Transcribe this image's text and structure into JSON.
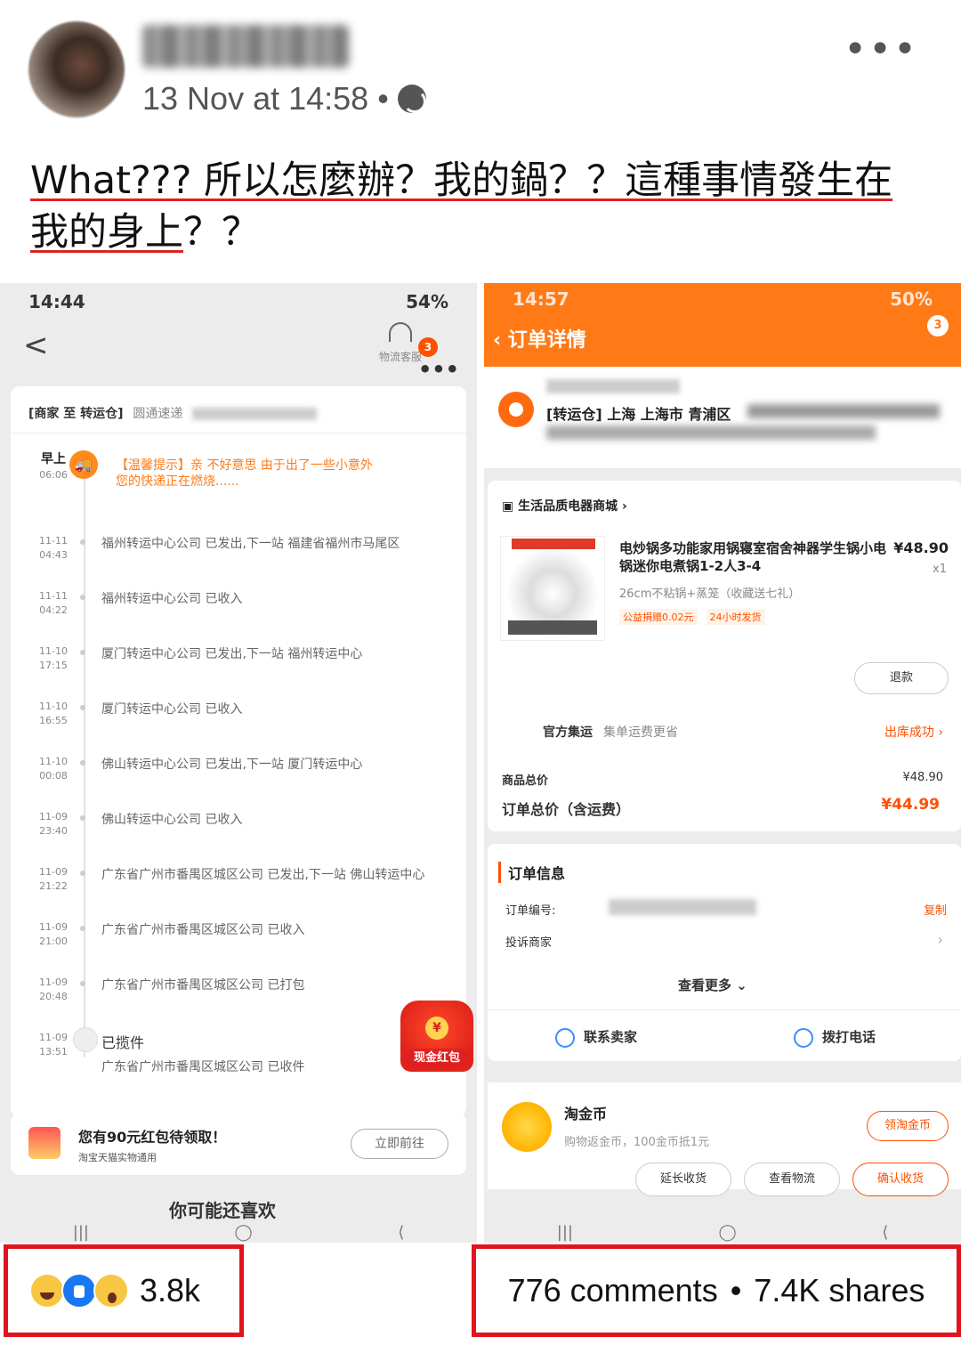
{
  "post": {
    "timestamp": "13 Nov at 14:58",
    "separator": "•",
    "caption_line1": "What??? 所以怎麼辦？我的鍋？？這種事情發生在",
    "caption_line2_u": "我的身上",
    "caption_line2_rest": "？？"
  },
  "left_phone": {
    "time": "14:44",
    "battery": "54%",
    "service_label": "物流客服",
    "badge": "3",
    "carrier_prefix": "[商家 至 转运仓]",
    "carrier_name": "圆通速递",
    "first_event": {
      "label": "早上",
      "time": "06:06",
      "text1": "【温馨提示】亲 不好意思 由于出了一些小意外",
      "text2": "您的快递正在燃烧......"
    },
    "events": [
      {
        "date": "11-11",
        "time": "04:43",
        "text": "福州转运中心公司 已发出,下一站 福建省福州市马尾区"
      },
      {
        "date": "11-11",
        "time": "04:22",
        "text": "福州转运中心公司 已收入"
      },
      {
        "date": "11-10",
        "time": "17:15",
        "text": "厦门转运中心公司 已发出,下一站 福州转运中心"
      },
      {
        "date": "11-10",
        "time": "16:55",
        "text": "厦门转运中心公司 已收入"
      },
      {
        "date": "11-10",
        "time": "00:08",
        "text": "佛山转运中心公司 已发出,下一站 厦门转运中心"
      },
      {
        "date": "11-09",
        "time": "23:40",
        "text": "佛山转运中心公司 已收入"
      },
      {
        "date": "11-09",
        "time": "21:22",
        "text": "广东省广州市番禺区城区公司 已发出,下一站 佛山转运中心"
      },
      {
        "date": "11-09",
        "time": "21:00",
        "text": "广东省广州市番禺区城区公司 已收入"
      },
      {
        "date": "11-09",
        "time": "20:48",
        "text": "广东省广州市番禺区城区公司 已打包"
      }
    ],
    "last_event": {
      "date": "11-09",
      "time": "13:51",
      "title": "已揽件",
      "text": "广东省广州市番禺区城区公司 已收件"
    },
    "redpacket_label": "现金红包",
    "promo_title": "您有90元红包待领取！",
    "promo_sub": "淘宝天猫实物通用",
    "promo_btn": "立即前往",
    "more_text": "你可能还喜欢"
  },
  "right_phone": {
    "time": "14:57",
    "battery": "50%",
    "title": "订单详情",
    "badge": "3",
    "address_line": "[转运仓] 上海 上海市 青浦区",
    "shop_name": "生活品质电器商城",
    "product_title": "电炒锅多功能家用锅寝室宿舍神器学生锅小电锅迷你电煮锅1-2人3-4",
    "price": "¥48.90",
    "qty": "x1",
    "variant": "26cm不粘锅+蒸笼（收藏送七礼）",
    "tag1": "公益捐赠0.02元",
    "tag2": "24小时发货",
    "refund": "退款",
    "ship_label": "官方集运",
    "ship_sub": "集单运费更省",
    "ship_status": "出库成功",
    "total_label": "商品总价",
    "total_value": "¥48.90",
    "order_total_label": "订单总价（含运费）",
    "order_total_value": "¥44.99",
    "info_header": "订单信息",
    "order_no_label": "订单编号:",
    "copy": "复制",
    "complain": "投诉商家",
    "see_more": "查看更多",
    "contact_seller": "联系卖家",
    "call": "拨打电话",
    "coin_title": "淘金币",
    "coin_sub": "购物返金币，100金币抵1元",
    "coin_btn": "领淘金币",
    "actions": [
      "延长收货",
      "查看物流",
      "确认收货"
    ]
  },
  "footer": {
    "reactions": "3.8k",
    "comments": "776 comments",
    "shares": "7.4K shares",
    "dot": "•"
  }
}
